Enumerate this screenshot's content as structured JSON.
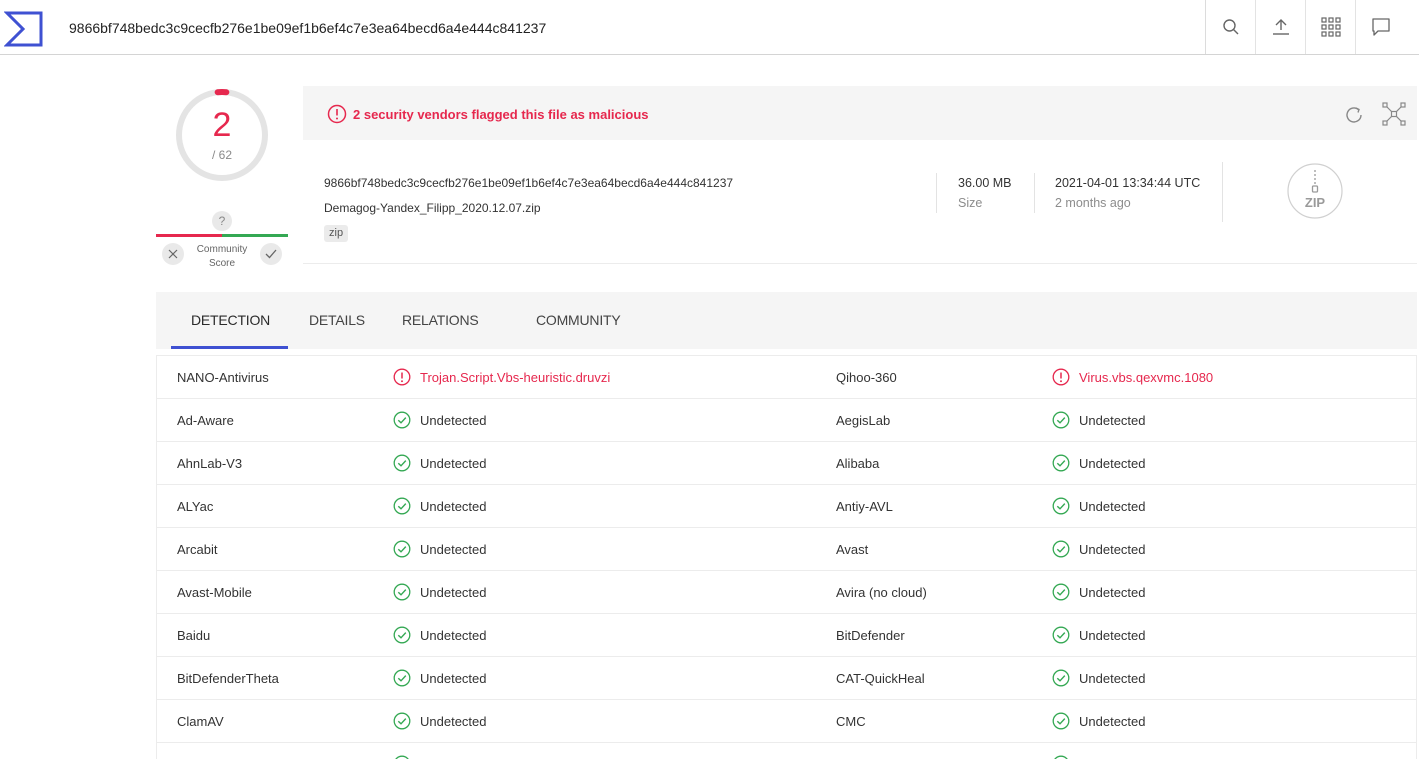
{
  "search": {
    "value": "9866bf748bedc3c9cecfb276e1be09ef1b6ef4c7e3ea64becd6a4e444c841237"
  },
  "top_actions": [
    "search-icon",
    "upload-icon",
    "apps-grid-icon",
    "chat-icon"
  ],
  "colors": {
    "malicious": "#e6284e",
    "clean": "#34a853",
    "accent": "#3f51d2"
  },
  "score": {
    "detections": "2",
    "total": "/ 62",
    "detection_fraction": 0.0323,
    "community_help": "?",
    "community_label_line1": "Community",
    "community_label_line2": "Score"
  },
  "alert": {
    "text": "2 security vendors flagged this file as malicious"
  },
  "file": {
    "hash": "9866bf748bedc3c9cecfb276e1be09ef1b6ef4c7e3ea64becd6a4e444c841237",
    "name": "Demagog-Yandex_Filipp_2020.12.07.zip",
    "tag": "zip",
    "size_value": "36.00 MB",
    "size_label": "Size",
    "date_value": "2021-04-01 13:34:44 UTC",
    "date_relative": "2 months ago",
    "type_icon_label": "ZIP"
  },
  "tabs": [
    {
      "label": "DETECTION",
      "active": true
    },
    {
      "label": "DETAILS",
      "active": false
    },
    {
      "label": "RELATIONS",
      "active": false
    },
    {
      "label": "COMMUNITY",
      "active": false
    }
  ],
  "detections": [
    {
      "left_vendor": "NANO-Antivirus",
      "left_result": "Trojan.Script.Vbs-heuristic.druvzi",
      "left_status": "malicious",
      "right_vendor": "Qihoo-360",
      "right_result": "Virus.vbs.qexvmc.1080",
      "right_status": "malicious"
    },
    {
      "left_vendor": "Ad-Aware",
      "left_result": "Undetected",
      "left_status": "clean",
      "right_vendor": "AegisLab",
      "right_result": "Undetected",
      "right_status": "clean"
    },
    {
      "left_vendor": "AhnLab-V3",
      "left_result": "Undetected",
      "left_status": "clean",
      "right_vendor": "Alibaba",
      "right_result": "Undetected",
      "right_status": "clean"
    },
    {
      "left_vendor": "ALYac",
      "left_result": "Undetected",
      "left_status": "clean",
      "right_vendor": "Antiy-AVL",
      "right_result": "Undetected",
      "right_status": "clean"
    },
    {
      "left_vendor": "Arcabit",
      "left_result": "Undetected",
      "left_status": "clean",
      "right_vendor": "Avast",
      "right_result": "Undetected",
      "right_status": "clean"
    },
    {
      "left_vendor": "Avast-Mobile",
      "left_result": "Undetected",
      "left_status": "clean",
      "right_vendor": "Avira (no cloud)",
      "right_result": "Undetected",
      "right_status": "clean"
    },
    {
      "left_vendor": "Baidu",
      "left_result": "Undetected",
      "left_status": "clean",
      "right_vendor": "BitDefender",
      "right_result": "Undetected",
      "right_status": "clean"
    },
    {
      "left_vendor": "BitDefenderTheta",
      "left_result": "Undetected",
      "left_status": "clean",
      "right_vendor": "CAT-QuickHeal",
      "right_result": "Undetected",
      "right_status": "clean"
    },
    {
      "left_vendor": "ClamAV",
      "left_result": "Undetected",
      "left_status": "clean",
      "right_vendor": "CMC",
      "right_result": "Undetected",
      "right_status": "clean"
    },
    {
      "left_vendor": "",
      "left_result": "",
      "left_status": "clean",
      "right_vendor": "",
      "right_result": "",
      "right_status": "clean"
    }
  ]
}
